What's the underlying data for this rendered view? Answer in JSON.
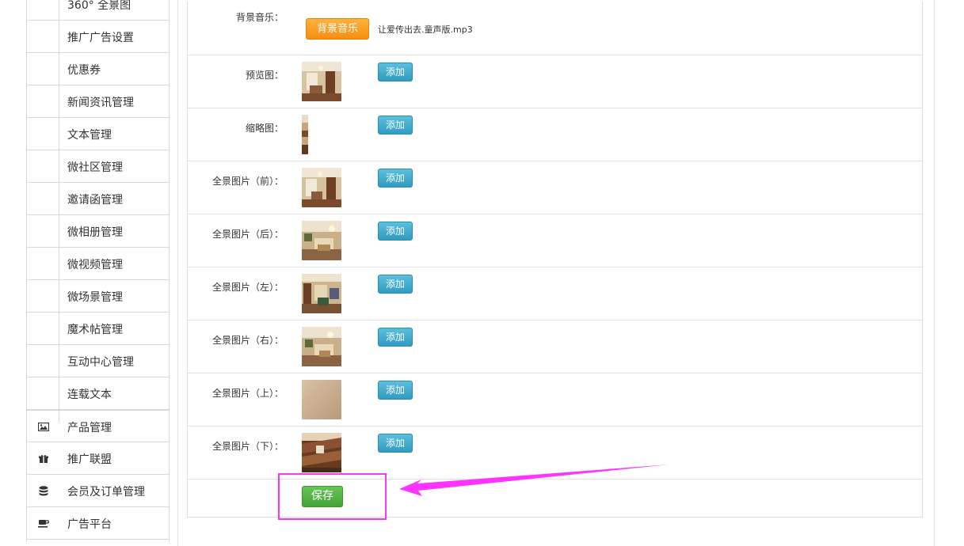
{
  "sidebar": {
    "items": [
      {
        "label": "360° 全景图"
      },
      {
        "label": "推广广告设置"
      },
      {
        "label": "优惠券"
      },
      {
        "label": "新闻资讯管理"
      },
      {
        "label": "文本管理"
      },
      {
        "label": "微社区管理"
      },
      {
        "label": "邀请函管理"
      },
      {
        "label": "微相册管理"
      },
      {
        "label": "微视频管理"
      },
      {
        "label": "微场景管理"
      },
      {
        "label": "魔术帖管理"
      },
      {
        "label": "互动中心管理"
      },
      {
        "label": "连载文本"
      },
      {
        "label": "产品管理",
        "icon": "image-icon"
      },
      {
        "label": "推广联盟",
        "icon": "gift-icon"
      },
      {
        "label": "会员及订单管理",
        "icon": "database-icon"
      },
      {
        "label": "广告平台",
        "icon": "coffee-icon"
      }
    ]
  },
  "form": {
    "music": {
      "label": "背景音乐：",
      "button": "背景音乐",
      "filename": "让爱传出去.童声版.mp3"
    },
    "add_label": "添加",
    "rows": [
      {
        "label": "预览图："
      },
      {
        "label": "缩略图："
      },
      {
        "label": "全景图片（前）："
      },
      {
        "label": "全景图片（后）："
      },
      {
        "label": "全景图片（左）："
      },
      {
        "label": "全景图片（右）："
      },
      {
        "label": "全景图片（上）："
      },
      {
        "label": "全景图片（下）："
      }
    ],
    "save": "保存"
  },
  "colors": {
    "accent_blue": "#2f9cc2",
    "music_orange": "#f58f12",
    "save_green": "#43a336",
    "annotation_magenta": "#ff33ff"
  }
}
